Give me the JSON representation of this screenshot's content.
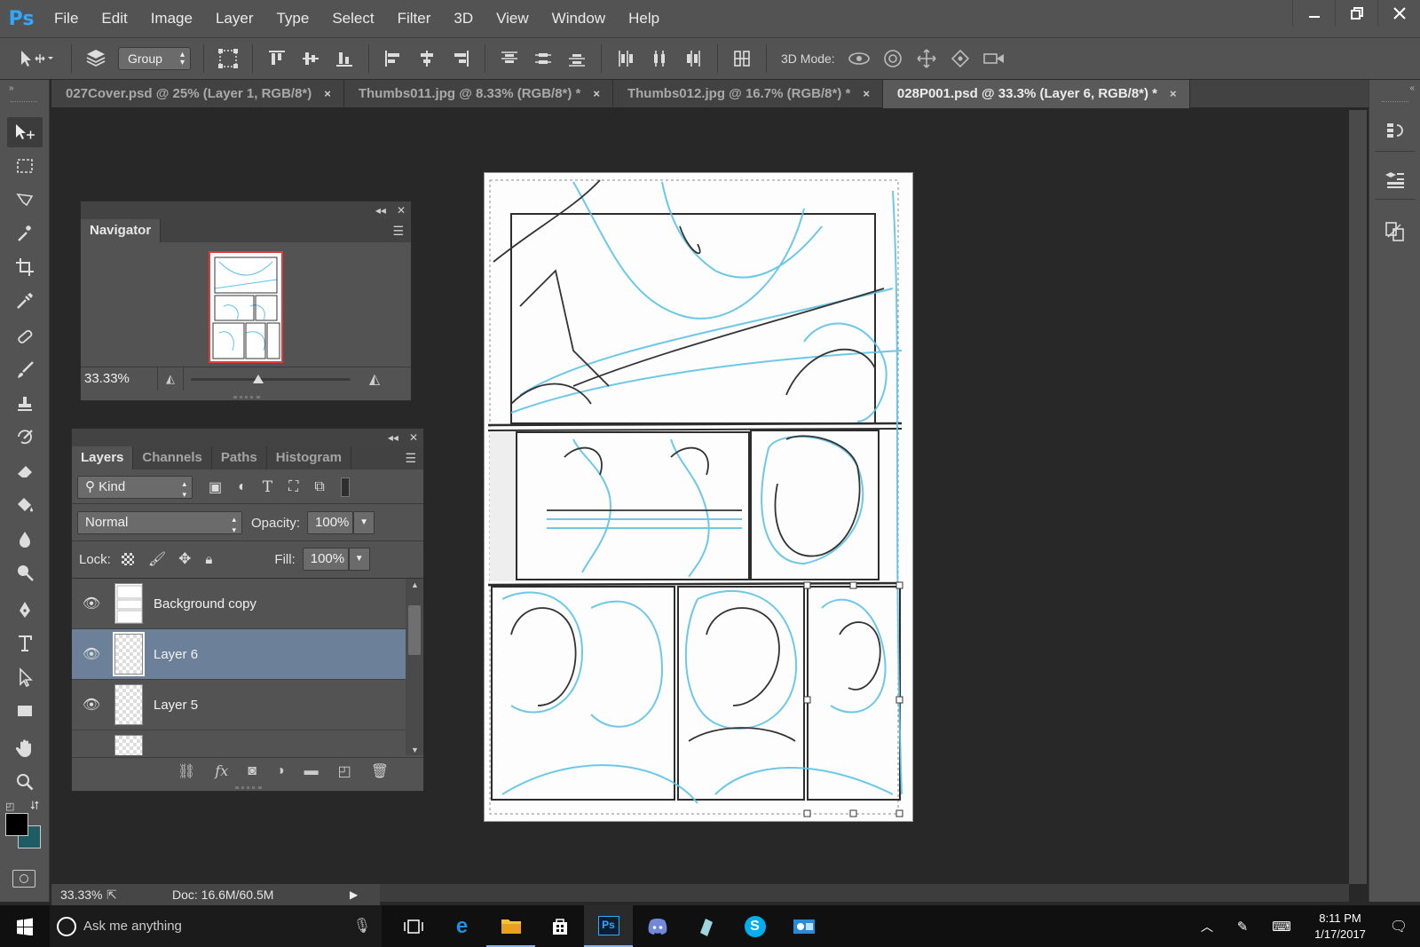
{
  "app": {
    "logo": "Ps"
  },
  "menu": [
    "File",
    "Edit",
    "Image",
    "Layer",
    "Type",
    "Select",
    "Filter",
    "3D",
    "View",
    "Window",
    "Help"
  ],
  "window_controls": {
    "minimize": "minimize-icon",
    "restore": "restore-icon",
    "close": "close-icon"
  },
  "options_bar": {
    "auto_select_value": "Group",
    "mode_3d_label": "3D Mode:"
  },
  "tabs": [
    {
      "label": "027Cover.psd @ 25% (Layer 1, RGB/8*)",
      "active": false
    },
    {
      "label": "Thumbs011.jpg @ 8.33% (RGB/8*) *",
      "active": false
    },
    {
      "label": "Thumbs012.jpg @ 16.7% (RGB/8*) *",
      "active": false
    },
    {
      "label": "028P001.psd @ 33.3% (Layer 6, RGB/8*) *",
      "active": true
    }
  ],
  "tab_close_glyph": "×",
  "navigator": {
    "title": "Navigator",
    "zoom": "33.33%",
    "zoom_level": 0.42
  },
  "layers_panel": {
    "tabs": [
      "Layers",
      "Channels",
      "Paths",
      "Histogram"
    ],
    "filter_kind": "Kind",
    "blend_mode": "Normal",
    "opacity_label": "Opacity:",
    "opacity_value": "100%",
    "lock_label": "Lock:",
    "fill_label": "Fill:",
    "fill_value": "100%",
    "layers": [
      {
        "name": "Background copy",
        "visible": true,
        "selected": false
      },
      {
        "name": "Layer 6",
        "visible": true,
        "selected": true
      },
      {
        "name": "Layer 5",
        "visible": true,
        "selected": false
      }
    ]
  },
  "status": {
    "zoom": "33.33%",
    "doc": "Doc: 16.6M/60.5M"
  },
  "taskbar": {
    "search_placeholder": "Ask me anything",
    "time": "8:11 PM",
    "date": "1/17/2017",
    "apps": [
      "task-view-icon",
      "edge-icon",
      "file-explorer-icon",
      "store-icon",
      "photoshop-icon",
      "discord-icon",
      "app-icon",
      "skype-icon",
      "outlook-icon"
    ]
  },
  "colors": {
    "accent": "#31a8ff",
    "selection": "#6c8099",
    "sketch_blue": "#5ec3e6"
  }
}
